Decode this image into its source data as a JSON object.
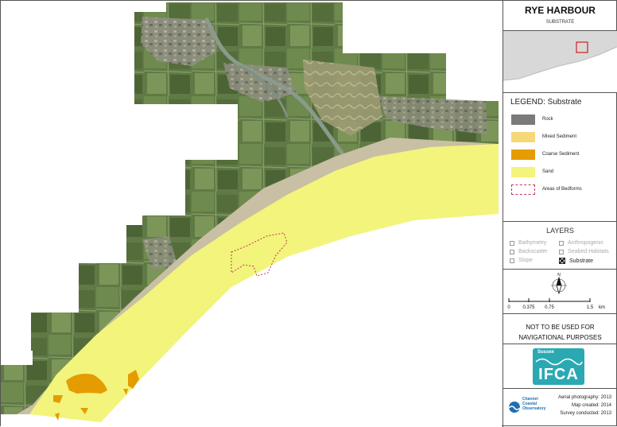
{
  "map": {
    "title": "RYE HARBOUR",
    "subtitle": "SUBSTRATE"
  },
  "legend": {
    "title": "LEGEND: Substrate",
    "items": [
      {
        "label": "Rock",
        "color": "#7a7a7a",
        "style": "fill"
      },
      {
        "label": "Mixed Sediment",
        "color": "#f6d87a",
        "style": "fill"
      },
      {
        "label": "Coarse Sediment",
        "color": "#e59c00",
        "style": "fill"
      },
      {
        "label": "Sand",
        "color": "#f2f47c",
        "style": "fill"
      },
      {
        "label": "Areas of Bedforms",
        "color": "#c0395a",
        "style": "dashed-outline"
      }
    ]
  },
  "layers": {
    "title": "LAYERS",
    "items": [
      {
        "label": "Bathymetry",
        "active": false
      },
      {
        "label": "Backscatter",
        "active": false
      },
      {
        "label": "Slope",
        "active": false
      },
      {
        "label": "Anthropogenic",
        "active": false
      },
      {
        "label": "Seabed Habitats",
        "active": false
      },
      {
        "label": "Substrate",
        "active": true
      }
    ]
  },
  "north_arrow": {
    "label": "N"
  },
  "scale_bar": {
    "ticks": [
      "0",
      "0.375",
      "0.75",
      "1.5"
    ],
    "unit": "km"
  },
  "disclaimer": {
    "line1": "NOT TO BE USED FOR",
    "line2": "NAVIGATIONAL PURPOSES"
  },
  "logo": {
    "region": "Sussex",
    "name": "IFCA",
    "color": "#2aa9b3"
  },
  "credits": {
    "observatory": [
      "Channel",
      "Coastal",
      "Observatory"
    ],
    "aerial": "Aerial photography:  2013",
    "created": "Map created:  2014",
    "survey": "Survey conducted:  2013"
  }
}
